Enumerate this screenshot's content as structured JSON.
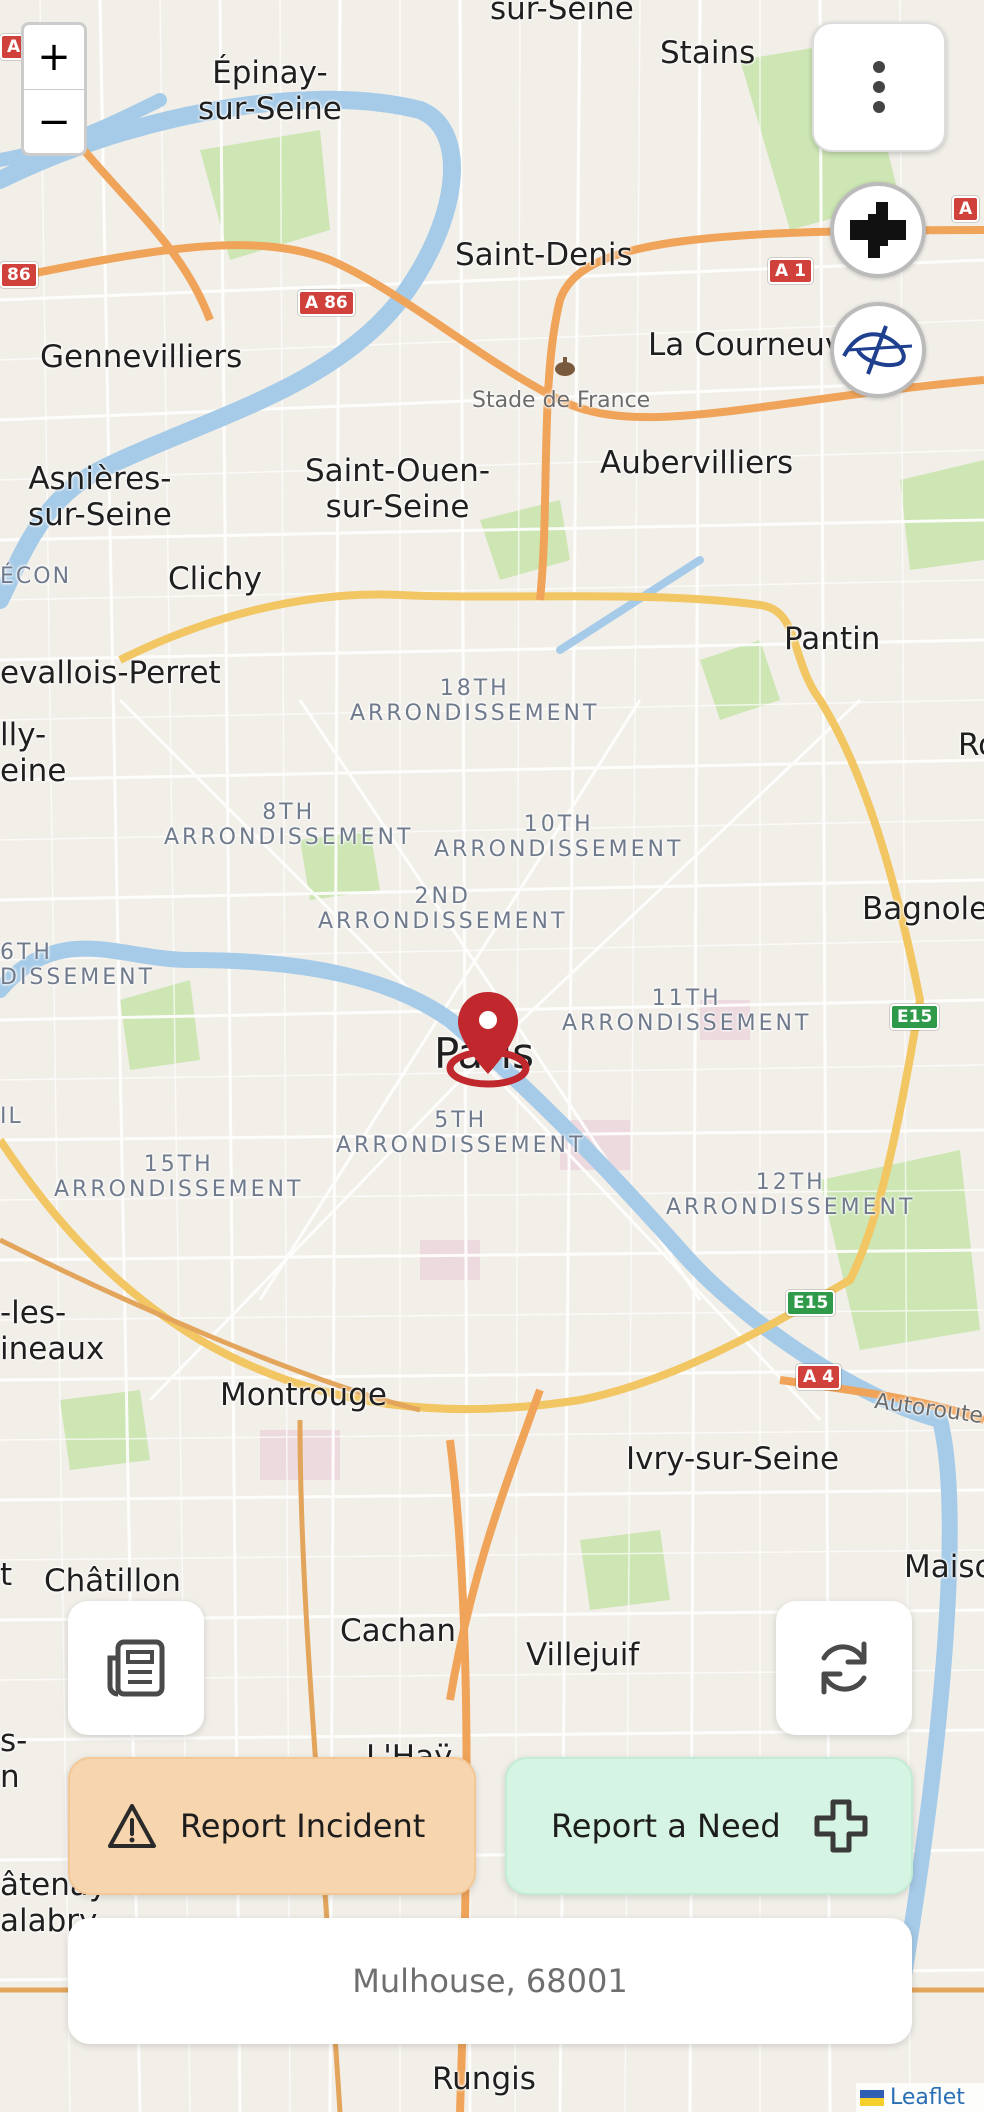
{
  "map": {
    "center_label": "Paris",
    "towns": {
      "sur_seine_top": "sur-Seine",
      "stains": "Stains",
      "epinay": "Épinay-\nsur-Seine",
      "saint_denis": "Saint-Denis",
      "gennevilliers": "Gennevilliers",
      "la_courneuve": "La Courneuve",
      "stade": "Stade de France",
      "asnieres": "Asnières-\nsur-Seine",
      "saint_ouen": "Saint-Ouen-\nsur-Seine",
      "aubervilliers": "Aubervilliers",
      "econ": "ÉCON",
      "clichy": "Clichy",
      "pantin": "Pantin",
      "levallois": "evallois-Perret",
      "neuilly": "lly-\neine",
      "ro": "Ro",
      "bagnolet": "Bagnolet",
      "les_moulineaux": "-les-\nineaux",
      "montrouge": "Montrouge",
      "ivry": "Ivry-sur-Seine",
      "autoroute": "Autoroute d",
      "t": "t",
      "chatillon": "Châtillon",
      "maiso": "Maiso",
      "cachan": "Cachan",
      "villejuif": "Villejuif",
      "s_n": "s-\nn",
      "lhay": "L'Haÿ",
      "chatenay": "âtenay\nalabry",
      "rungis": "Rungis",
      "il": "IL"
    },
    "arrondissements": {
      "a18": "18TH\nARRONDISSEMENT",
      "a8": "8TH\nARRONDISSEMENT",
      "a10": "10TH\nARRONDISSEMENT",
      "a2": "2ND\nARRONDISSEMENT",
      "a16": "6TH\nDISSEMENT",
      "a11": "11TH\nARRONDISSEMENT",
      "a5": "5TH\nARRONDISSEMENT",
      "a15": "15TH\nARRONDISSEMENT",
      "a12": "12TH\nARRONDISSEMENT"
    },
    "road_shields": {
      "a1_top": "A",
      "a1_right": "A",
      "a86_left": "86",
      "a86": "A 86",
      "a1": "A 1",
      "e15_upper": "E15",
      "e15_lower": "E15",
      "a4": "A 4"
    }
  },
  "controls": {
    "zoom_in": "+",
    "zoom_out": "−",
    "menu_icon": "kebab-menu-icon",
    "news_icon": "newspaper-icon",
    "refresh_icon": "refresh-icon"
  },
  "actions": {
    "report_incident": "Report Incident",
    "report_need": "Report a Need"
  },
  "location": {
    "value": "Mulhouse, 68001"
  },
  "attribution": {
    "label": "Leaflet"
  },
  "colors": {
    "incident_bg": "#f7d5ae",
    "need_bg": "#d5f4e3",
    "marker": "#c0282d",
    "water": "#a6cbe8",
    "park": "#cde6b4",
    "highway": "#f2c662"
  }
}
